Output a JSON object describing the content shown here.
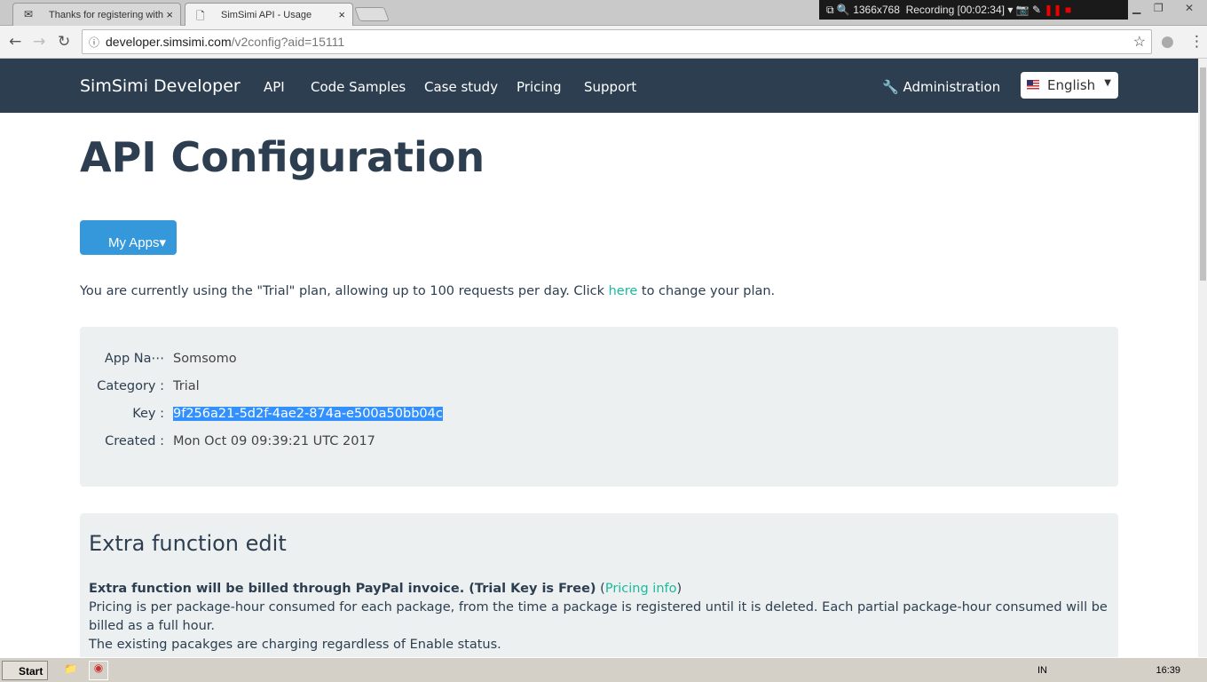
{
  "browser": {
    "tabs": [
      {
        "label": "Thanks for registering with"
      },
      {
        "label": "SimSimi API - Usage"
      }
    ],
    "url_host": "developer.simsimi.com",
    "url_path": "/v2config?aid=15111"
  },
  "recorder": {
    "resolution": "1366x768",
    "status": "Recording [00:02:34]"
  },
  "navbar": {
    "brand": "SimSimi Developer",
    "items": [
      "API",
      "Code Samples",
      "Case study",
      "Pricing",
      "Support"
    ],
    "admin": "Administration",
    "language": "English"
  },
  "page": {
    "title": "API Configuration",
    "my_apps": "My Apps",
    "plan_text_before": "You are currently using the \"Trial\" plan, allowing up to 100 requests per day. Click ",
    "plan_link": "here",
    "plan_text_after": " to change your plan."
  },
  "app": {
    "rows": [
      {
        "label": "App Na⋯",
        "value": "Somsomo"
      },
      {
        "label": "Category :",
        "value": "Trial"
      },
      {
        "label": "Key :",
        "value": "9f256a21-5d2f-4ae2-874a-e500a50bb04c"
      },
      {
        "label": "Created :",
        "value": "Mon Oct 09 09:39:21 UTC 2017"
      }
    ]
  },
  "extra": {
    "title": "Extra function edit",
    "billing_bold": "Extra function will be billed through PayPal invoice. (Trial Key is Free)",
    "pricing_link": "Pricing info",
    "line2": "Pricing is per package-hour consumed for each package, from the time a package is registered until it is deleted. Each partial package-hour consumed will be billed as a full hour.",
    "line3": "The existing pacakges are charging regardless of Enable status."
  },
  "taskbar": {
    "start": "Start",
    "lang": "IN",
    "time": "16:39"
  }
}
